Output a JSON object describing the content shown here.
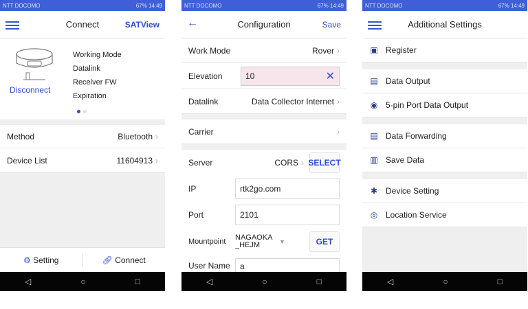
{
  "status_bar": {
    "carrier": "NTT DOCOMO",
    "right": "67% 14:49"
  },
  "screen1": {
    "title": "Connect",
    "action": "SATView",
    "device": {
      "status_label": "Disconnect",
      "info": [
        "Working Mode",
        "Datalink",
        "Receiver FW",
        "Expiration"
      ]
    },
    "rows": [
      {
        "label": "Method",
        "value": "Bluetooth"
      },
      {
        "label": "Device List",
        "value": "11604913"
      }
    ],
    "footer": {
      "setting": "Setting",
      "connect": "Connect"
    }
  },
  "screen2": {
    "title": "Configuration",
    "action": "Save",
    "work_mode": {
      "label": "Work Mode",
      "value": "Rover"
    },
    "elevation": {
      "label": "Elevation",
      "value": "10"
    },
    "datalink": {
      "label": "Datalink",
      "value": "Data Collector Internet"
    },
    "carrier": {
      "label": "Carrier"
    },
    "server": {
      "label": "Server",
      "value": "CORS",
      "button": "SELECT"
    },
    "ip": {
      "label": "IP",
      "value": "rtk2go.com"
    },
    "port": {
      "label": "Port",
      "value": "2101"
    },
    "mountpoint": {
      "label": "Mountpoint",
      "value": "NAGAOKA_HEJM",
      "button": "GET"
    },
    "username": {
      "label": "User Name",
      "value": "a"
    }
  },
  "screen3": {
    "title": "Additional Settings",
    "groups": [
      [
        "Register"
      ],
      [
        "Data Output",
        "5-pin Port Data Output"
      ],
      [
        "Data Forwarding",
        "Save Data"
      ],
      [
        "Device Setting",
        "Location Service"
      ]
    ]
  },
  "icons": {
    "menu": "hamburger-icon",
    "back": "back-arrow-icon",
    "clear": "close-icon"
  },
  "colors": {
    "accent": "#2e4bd1",
    "status_bar": "#3e5fd8"
  }
}
